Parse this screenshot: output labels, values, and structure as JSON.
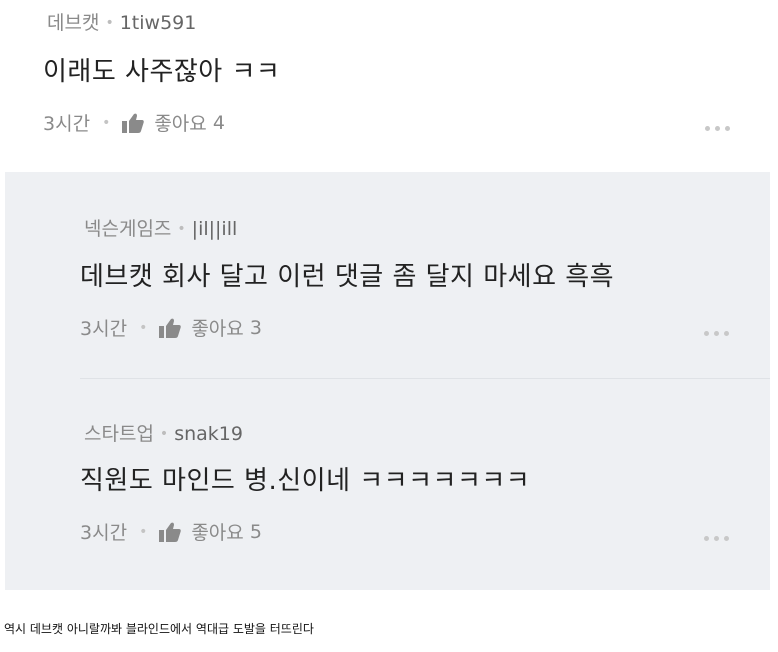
{
  "comments": [
    {
      "category": "데브캣",
      "username": "1tiw591",
      "text": "이래도 사주잖아 ㅋㅋ",
      "time": "3시간",
      "like_label": "좋아요",
      "like_count": "4"
    }
  ],
  "replies": [
    {
      "category": "넥슨게임즈",
      "username": "|il||ill",
      "text": "데브캣 회사 달고 이런 댓글 좀 달지 마세요 흑흑",
      "time": "3시간",
      "like_label": "좋아요",
      "like_count": "3"
    },
    {
      "category": "스타트업",
      "username": "snak19",
      "text": "직원도 마인드 병.신이네 ㅋㅋㅋㅋㅋㅋㅋ",
      "time": "3시간",
      "like_label": "좋아요",
      "like_count": "5"
    }
  ],
  "caption": "역시 데브캣 아니랄까봐 블라인드에서 역대급 도발을 터뜨린다",
  "colors": {
    "reply_background": "#eef0f3",
    "meta_text": "#8a8a8a",
    "body_text": "#222222"
  },
  "icons": {
    "like": "thumbs-up-icon",
    "more": "more-dots-icon"
  }
}
